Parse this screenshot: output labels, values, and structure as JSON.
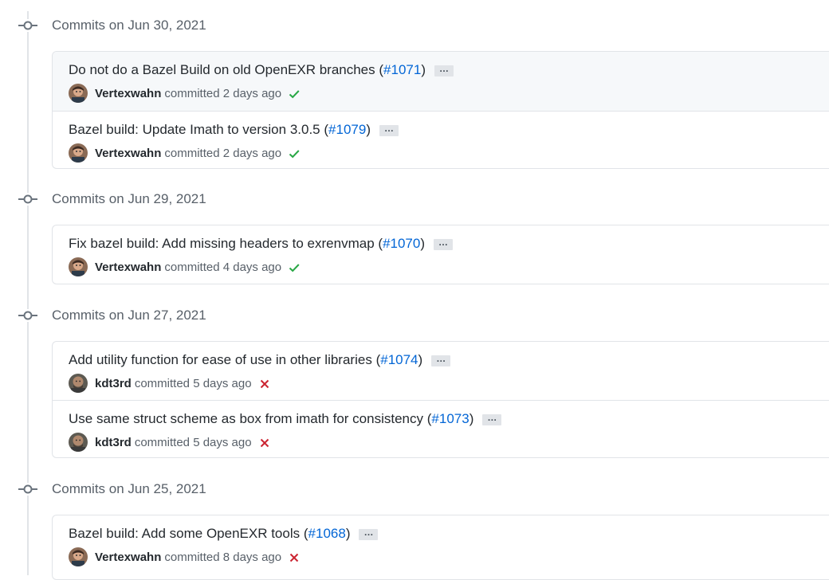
{
  "groups": [
    {
      "date_label": "Commits on Jun 30, 2021",
      "commits": [
        {
          "title": "Do not do a Bazel Build on old OpenEXR branches",
          "pr": "#1071",
          "ellipsis": "…",
          "author": "Vertexwahn",
          "committed_text": "committed 2 days ago",
          "status": "success"
        },
        {
          "title": "Bazel build: Update Imath to version 3.0.5",
          "pr": "#1079",
          "ellipsis": "…",
          "author": "Vertexwahn",
          "committed_text": "committed 2 days ago",
          "status": "success"
        }
      ]
    },
    {
      "date_label": "Commits on Jun 29, 2021",
      "commits": [
        {
          "title": "Fix bazel build: Add missing headers to exrenvmap",
          "pr": "#1070",
          "ellipsis": "…",
          "author": "Vertexwahn",
          "committed_text": "committed 4 days ago",
          "status": "success"
        }
      ]
    },
    {
      "date_label": "Commits on Jun 27, 2021",
      "commits": [
        {
          "title": "Add utility function for ease of use in other libraries",
          "pr": "#1074",
          "ellipsis": "…",
          "author": "kdt3rd",
          "committed_text": "committed 5 days ago",
          "status": "failure"
        },
        {
          "title": "Use same struct scheme as box from imath for consistency",
          "pr": "#1073",
          "ellipsis": "…",
          "author": "kdt3rd",
          "committed_text": "committed 5 days ago",
          "status": "failure"
        }
      ]
    },
    {
      "date_label": "Commits on Jun 25, 2021",
      "commits": [
        {
          "title": "Bazel build: Add some OpenEXR tools",
          "pr": "#1068",
          "ellipsis": "…",
          "author": "Vertexwahn",
          "committed_text": "committed 8 days ago",
          "status": "failure"
        }
      ]
    }
  ],
  "colors": {
    "success": "#28a745",
    "failure": "#cb2431",
    "link": "#0366d6",
    "muted": "#586069",
    "border": "#e1e4e8"
  },
  "icons": {
    "commit": "git-commit-icon",
    "success": "check-icon",
    "failure": "x-icon"
  }
}
